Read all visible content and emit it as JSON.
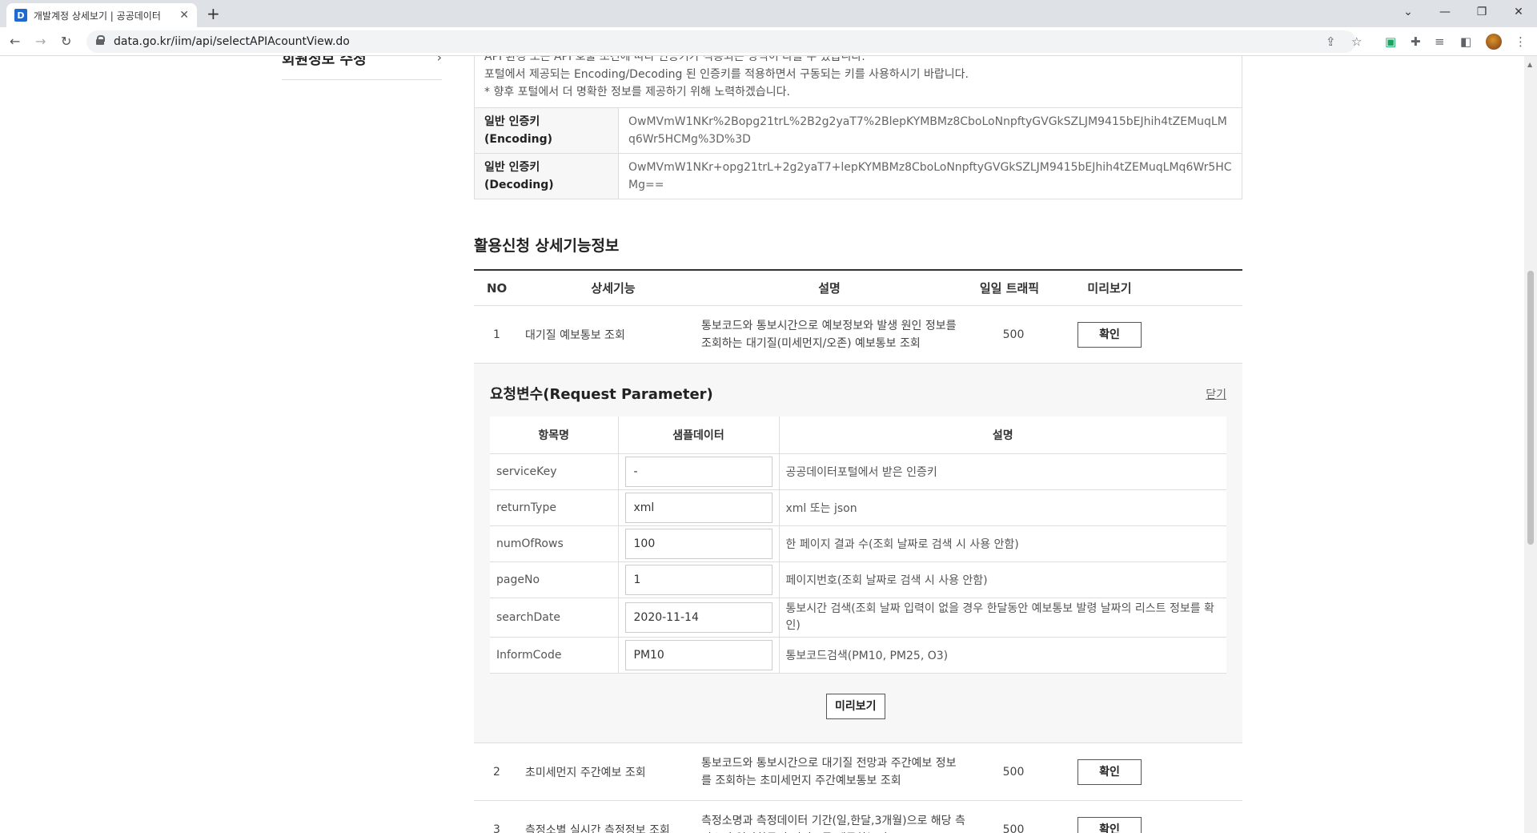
{
  "browser": {
    "tab_title": "개발계정 상세보기 | 공공데이터",
    "favicon": "D",
    "url": "data.go.kr/iim/api/selectAPIAcountView.do"
  },
  "sidebar": {
    "label": "회원정보 수정"
  },
  "notice": {
    "line1": "API 환경 또는 API 호출 조건에 따라 인증키가 적용되는 방식이 다를 수 있습니다.",
    "line2": "포털에서 제공되는 Encoding/Decoding 된 인증키를 적용하면서 구동되는 키를 사용하시기 바랍니다.",
    "line3": "* 향후 포털에서 더 명확한 정보를 제공하기 위해 노력하겠습니다."
  },
  "keys": [
    {
      "label1": "일반 인증키",
      "label2": "(Encoding)",
      "value": "OwMVmW1NKr%2Bopg21trL%2B2g2yaT7%2BlepKYMBMz8CboLoNnpftyGVGkSZLJM9415bEJhih4tZEMuqLMq6Wr5HCMg%3D%3D"
    },
    {
      "label1": "일반 인증키",
      "label2": "(Decoding)",
      "value": "OwMVmW1NKr+opg21trL+2g2yaT7+lepKYMBMz8CboLoNnpftyGVGkSZLJM9415bEJhih4tZEMuqLMq6Wr5HCMg=="
    }
  ],
  "section_title": "활용신청 상세기능정보",
  "func_table": {
    "headers": {
      "no": "NO",
      "function": "상세기능",
      "desc": "설명",
      "traffic": "일일 트래픽",
      "preview": "미리보기"
    },
    "rows": [
      {
        "no": "1",
        "function": "대기질 예보통보 조회",
        "desc": "통보코드와 통보시간으로 예보정보와 발생 원인 정보를 조회하는 대기질(미세먼지/오존) 예보통보 조회",
        "traffic": "500",
        "button": "확인"
      },
      {
        "no": "2",
        "function": "초미세먼지 주간예보 조회",
        "desc": "통보코드와 통보시간으로 대기질 전망과 주간예보 정보를 조회하는 초미세먼지 주간예보통보 조회",
        "traffic": "500",
        "button": "확인"
      },
      {
        "no": "3",
        "function": "측정소별 실시간 측정정보 조회",
        "desc": "측정소명과 측정데이터 기간(일,한달,3개월)으로 해당 측정소의 일반항목 측정정보를 제공하는 측",
        "traffic": "500",
        "button": "확인"
      }
    ]
  },
  "request": {
    "title": "요청변수(Request Parameter)",
    "close": "닫기",
    "headers": {
      "name": "항목명",
      "sample": "샘플데이터",
      "desc": "설명"
    },
    "params": [
      {
        "name": "serviceKey",
        "value": "-",
        "desc": "공공데이터포털에서 받은 인증키"
      },
      {
        "name": "returnType",
        "value": "xml",
        "desc": "xml 또는 json"
      },
      {
        "name": "numOfRows",
        "value": "100",
        "desc": "한 페이지 결과 수(조회 날짜로 검색 시 사용 안함)"
      },
      {
        "name": "pageNo",
        "value": "1",
        "desc": "페이지번호(조회 날짜로 검색 시 사용 안함)"
      },
      {
        "name": "searchDate",
        "value": "2020-11-14",
        "desc": "통보시간 검색(조회 날짜 입력이 없을 경우 한달동안 예보통보 발령 날짜의 리스트 정보를 확인)"
      },
      {
        "name": "InformCode",
        "value": "PM10",
        "desc": "통보코드검색(PM10, PM25, O3)"
      }
    ],
    "preview_button": "미리보기"
  }
}
